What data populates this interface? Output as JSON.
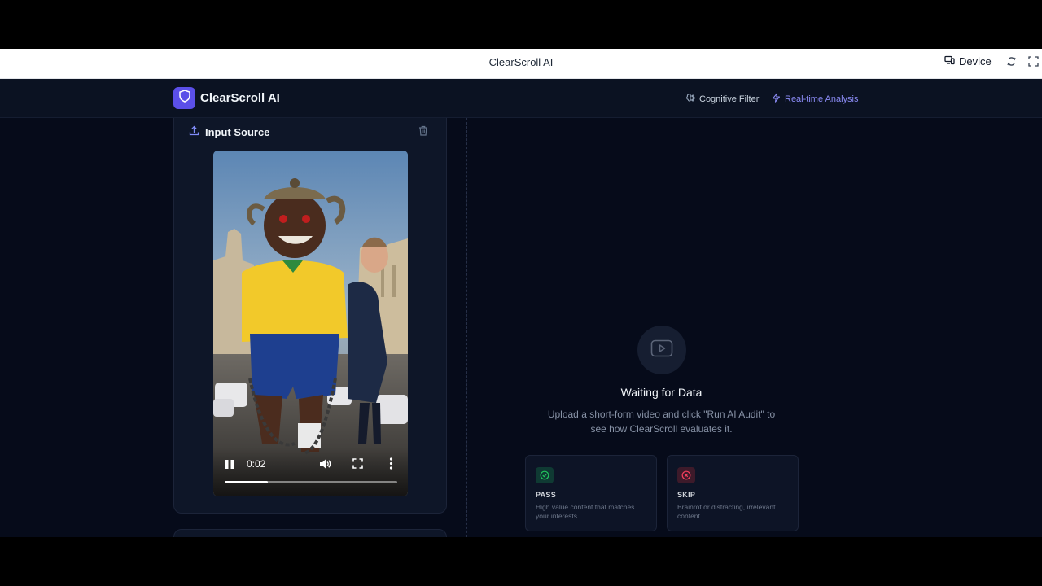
{
  "browser": {
    "title": "ClearScroll AI",
    "device_label": "Device"
  },
  "nav": {
    "brand": "ClearScroll AI",
    "links": [
      {
        "label": "Cognitive Filter"
      },
      {
        "label": "Real-time Analysis"
      }
    ]
  },
  "input_card": {
    "title": "Input Source",
    "video": {
      "current_time": "0:02",
      "progress": 0.25
    }
  },
  "results": {
    "title": "Waiting for Data",
    "subtitle": "Upload a short-form video and click \"Run AI Audit\" to see how ClearScroll evaluates it.",
    "tiles": [
      {
        "label": "PASS",
        "description": "High value content that matches your interests."
      },
      {
        "label": "SKIP",
        "description": "Brainrot or distracting, irrelevant content."
      }
    ]
  },
  "colors": {
    "accent": "#5b4fe8",
    "pass": "#22c55e",
    "skip": "#f43f5e",
    "background": "#060b1a"
  }
}
